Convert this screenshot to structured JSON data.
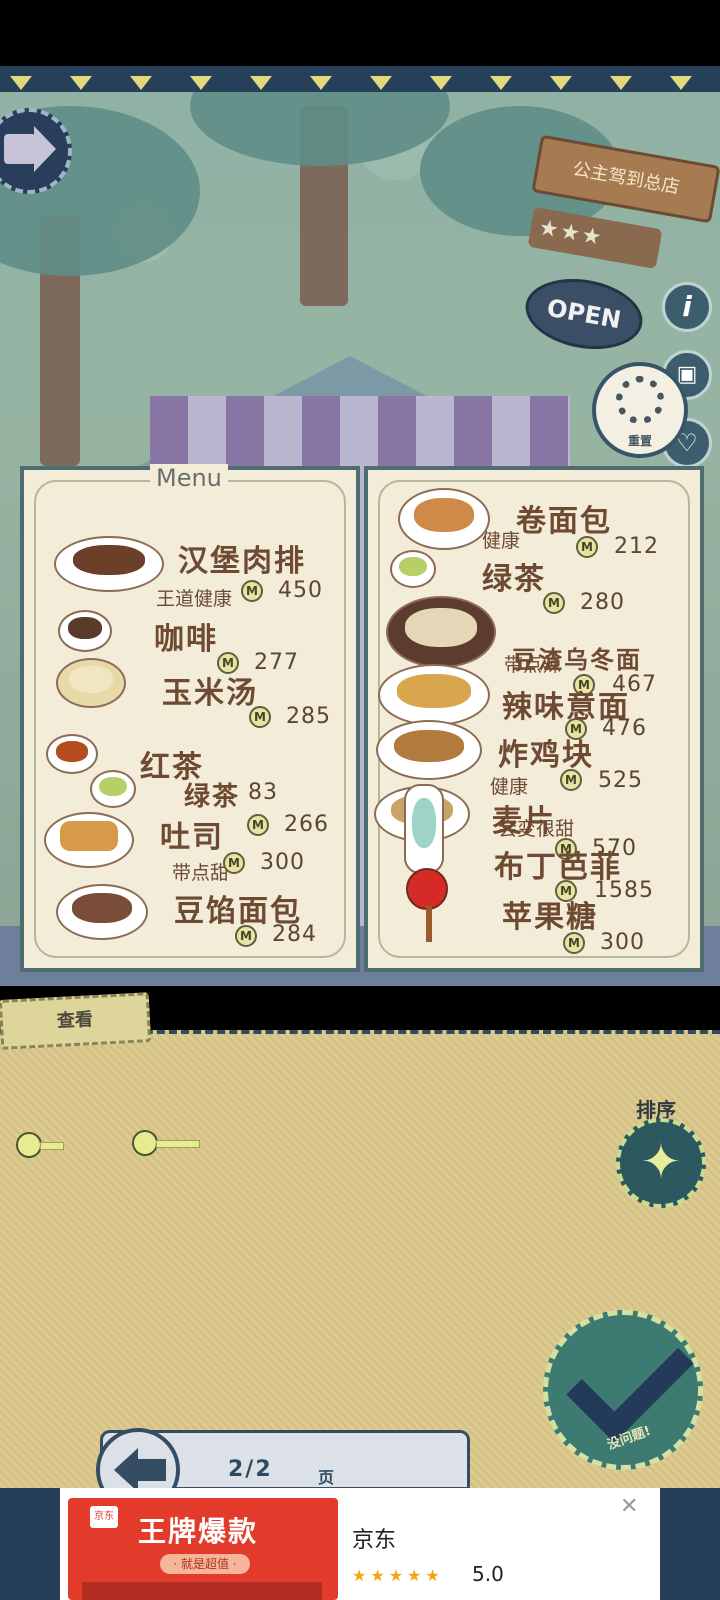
{
  "scene": {
    "store_sign": "公主驾到总店",
    "store_stars": "★★★",
    "open_label": "OPEN",
    "info_glyph": "i",
    "book_glyph": "▣",
    "heart_glyph": "♡",
    "reset_label": "重置"
  },
  "menu": {
    "title": "Menu",
    "left": [
      {
        "name": "汉堡肉排",
        "tag": "王道健康",
        "price": "450"
      },
      {
        "name": "咖啡",
        "tag": "",
        "price": "277"
      },
      {
        "name": "玉米汤",
        "tag": "",
        "price": "285"
      },
      {
        "name": "红茶",
        "tag": "",
        "price": "83"
      },
      {
        "name": "绿茶",
        "tag": "",
        "price": ""
      },
      {
        "name": "吐司",
        "tag": "",
        "price": "266"
      },
      {
        "name": "",
        "tag": "带点甜",
        "price": "300"
      },
      {
        "name": "豆馅面包",
        "tag": "",
        "price": "284"
      }
    ],
    "right": [
      {
        "name": "卷面包",
        "tag": "健康",
        "price": "212"
      },
      {
        "name": "绿茶",
        "tag": "",
        "price": "280"
      },
      {
        "name": "豆渣乌冬面",
        "tag": "带点辣",
        "price": "467"
      },
      {
        "name": "辣味意面",
        "tag": "",
        "price": "476"
      },
      {
        "name": "炸鸡块",
        "tag": "健康",
        "price": "525"
      },
      {
        "name": "麦片",
        "tag": "会变很甜",
        "price": "570"
      },
      {
        "name": "布丁芭菲",
        "tag": "",
        "price": "1585"
      },
      {
        "name": "苹果糖",
        "tag": "",
        "price": "300"
      }
    ],
    "coin_glyph": "M"
  },
  "board": {
    "view_tab": "查看",
    "sort_label": "排序",
    "sort_glyph": "✦",
    "ok_label": "没问题!",
    "page_indicator": "2/2",
    "page_unit": "页"
  },
  "ad": {
    "headline": "王牌爆款",
    "subline": "· 就是超值 ·",
    "logo_text": "京东",
    "brand": "京东",
    "stars": "★★★★★",
    "rating": "5.0",
    "close_glyph": "✕"
  }
}
